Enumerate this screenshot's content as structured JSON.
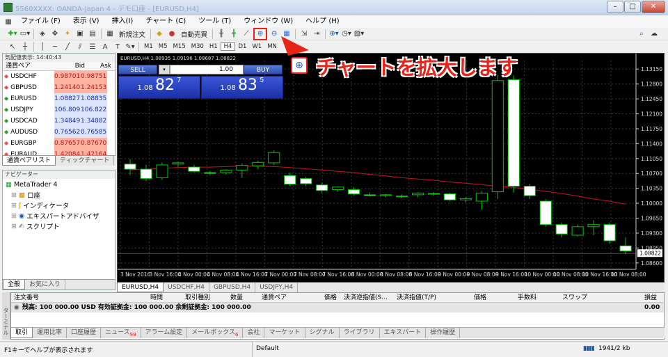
{
  "window": {
    "title": "5560XXXX: OANDA-Japan 4 - デモ口座 - [EURUSD,H4]",
    "min": "–",
    "max": "□",
    "close": "✕"
  },
  "menu": [
    "ファイル (F)",
    "表示 (V)",
    "挿入(I)",
    "チャート (C)",
    "ツール (T)",
    "ウィンドウ (W)",
    "ヘルプ (H)"
  ],
  "toolbar": {
    "new_order": "新規注文",
    "auto_trade": "自動売買",
    "timeframes": [
      "M1",
      "M5",
      "M15",
      "M30",
      "H1",
      "H4",
      "D1",
      "W1",
      "MN"
    ],
    "active_tf": "H4"
  },
  "callout": {
    "text": "チャートを拡大します",
    "color": "#e8231a"
  },
  "market_watch": {
    "header": "気配値表示: 14:40:43",
    "cols": [
      "通貨ペア",
      "Bid",
      "Ask"
    ],
    "rows": [
      {
        "sym": "USDCHF",
        "bid": "0.98701",
        "ask": "0.98751",
        "dir": "down"
      },
      {
        "sym": "GBPUSD",
        "bid": "1.24140",
        "ask": "1.24153",
        "dir": "down"
      },
      {
        "sym": "EURUSD",
        "bid": "1.08827",
        "ask": "1.08835",
        "dir": "up"
      },
      {
        "sym": "USDJPY",
        "bid": "106.809",
        "ask": "106.822",
        "dir": "up"
      },
      {
        "sym": "USDCAD",
        "bid": "1.34849",
        "ask": "1.34882",
        "dir": "up"
      },
      {
        "sym": "AUDUSD",
        "bid": "0.76562",
        "ask": "0.76585",
        "dir": "up"
      },
      {
        "sym": "EURGBP",
        "bid": "0.87657",
        "ask": "0.87670",
        "dir": "down"
      },
      {
        "sym": "EURAUD",
        "bid": "1.42084",
        "ask": "1.42164",
        "dir": "down"
      }
    ],
    "tabs": [
      "通貨ペアリスト",
      "ティックチャート"
    ]
  },
  "navigator": {
    "header": "ナビゲーター",
    "root": "MetaTrader 4",
    "items": [
      "口座",
      "インディケータ",
      "エキスパートアドバイザ",
      "スクリプト"
    ],
    "tabs": [
      "全般",
      "お気に入り"
    ]
  },
  "trade_panel": {
    "sell": "SELL",
    "buy": "BUY",
    "lot": "1.00",
    "sell_price_small": "1.08",
    "sell_price_big": "82",
    "sell_price_sup": "7",
    "buy_price_small": "1.08",
    "buy_price_big": "83",
    "buy_price_sup": "5"
  },
  "chart_tabs": [
    "EURUSD,H4",
    "USDCHF,H4",
    "GBPUSD,H4",
    "USDJPY,H4"
  ],
  "chart_data": {
    "type": "candlestick",
    "title": "EURUSD,H4 1.08935 1.09196 1.08687 1.08822",
    "x_labels": [
      "3 Nov 2016",
      "3 Nov 16:00",
      "4 Nov 00:00",
      "4 Nov 08:00",
      "4 Nov 16:00",
      "7 Nov 00:00",
      "7 Nov 08:00",
      "7 Nov 16:00",
      "8 Nov 00:00",
      "8 Nov 08:00",
      "8 Nov 16:00",
      "9 Nov 00:00",
      "9 Nov 08:00",
      "9 Nov 16:00",
      "10 Nov 00:00",
      "10 Nov 08:00",
      "10 Nov 16:00",
      "10 Nov 08:00"
    ],
    "y_ticks": [
      "1.13150",
      "1.12800",
      "1.12450",
      "1.12100",
      "1.11750",
      "1.11400",
      "1.11050",
      "1.10700",
      "1.10350",
      "1.10000",
      "1.09650",
      "1.09300",
      "1.08950",
      "1.08600"
    ],
    "ylim": [
      1.0845,
      1.1335
    ],
    "current_price": "1.08822",
    "candles": [
      {
        "o": 1.1092,
        "h": 1.1104,
        "l": 1.1066,
        "c": 1.108
      },
      {
        "o": 1.108,
        "h": 1.109,
        "l": 1.1052,
        "c": 1.1058
      },
      {
        "o": 1.106,
        "h": 1.1096,
        "l": 1.1055,
        "c": 1.109
      },
      {
        "o": 1.1092,
        "h": 1.1098,
        "l": 1.1084,
        "c": 1.1095
      },
      {
        "o": 1.1085,
        "h": 1.109,
        "l": 1.1072,
        "c": 1.1075
      },
      {
        "o": 1.1072,
        "h": 1.1076,
        "l": 1.1066,
        "c": 1.107
      },
      {
        "o": 1.1072,
        "h": 1.108,
        "l": 1.1068,
        "c": 1.1078
      },
      {
        "o": 1.1078,
        "h": 1.1094,
        "l": 1.106,
        "c": 1.1089
      },
      {
        "o": 1.1088,
        "h": 1.11,
        "l": 1.108,
        "c": 1.1096
      },
      {
        "o": 1.1095,
        "h": 1.1124,
        "l": 1.109,
        "c": 1.1119
      },
      {
        "o": 1.1065,
        "h": 1.1072,
        "l": 1.104,
        "c": 1.1045
      },
      {
        "o": 1.1058,
        "h": 1.1062,
        "l": 1.104,
        "c": 1.1046
      },
      {
        "o": 1.1043,
        "h": 1.1048,
        "l": 1.1025,
        "c": 1.103
      },
      {
        "o": 1.1032,
        "h": 1.104,
        "l": 1.1027,
        "c": 1.1038
      },
      {
        "o": 1.1032,
        "h": 1.1038,
        "l": 1.1018,
        "c": 1.1022
      },
      {
        "o": 1.102,
        "h": 1.1025,
        "l": 1.1016,
        "c": 1.1018
      },
      {
        "o": 1.1018,
        "h": 1.1022,
        "l": 1.1014,
        "c": 1.102
      },
      {
        "o": 1.1017,
        "h": 1.1021,
        "l": 1.1012,
        "c": 1.1016
      },
      {
        "o": 1.102,
        "h": 1.1026,
        "l": 1.1014,
        "c": 1.1024
      },
      {
        "o": 1.1022,
        "h": 1.1026,
        "l": 1.1018,
        "c": 1.1023
      },
      {
        "o": 1.1022,
        "h": 1.1025,
        "l": 1.1005,
        "c": 1.1008
      },
      {
        "o": 1.1008,
        "h": 1.1014,
        "l": 1.1002,
        "c": 1.1011
      },
      {
        "o": 1.1005,
        "h": 1.1028,
        "l": 1.0985,
        "c": 1.1024
      },
      {
        "o": 1.1027,
        "h": 1.1302,
        "l": 1.101,
        "c": 1.1288
      },
      {
        "o": 1.129,
        "h": 1.13,
        "l": 1.1025,
        "c": 1.104
      },
      {
        "o": 1.104,
        "h": 1.1046,
        "l": 1.101,
        "c": 1.1018
      },
      {
        "o": 1.1005,
        "h": 1.101,
        "l": 1.0945,
        "c": 1.095
      },
      {
        "o": 1.095,
        "h": 1.0955,
        "l": 1.092,
        "c": 1.0928
      },
      {
        "o": 1.0925,
        "h": 1.095,
        "l": 1.0922,
        "c": 1.0945
      },
      {
        "o": 1.0945,
        "h": 1.096,
        "l": 1.0925,
        "c": 1.095
      },
      {
        "o": 1.095,
        "h": 1.0955,
        "l": 1.0905,
        "c": 1.0912
      },
      {
        "o": 1.09,
        "h": 1.092,
        "l": 1.088,
        "c": 1.0888
      }
    ],
    "ma": [
      1.1078,
      1.108,
      1.1082,
      1.1084,
      1.1085,
      1.1085,
      1.1086,
      1.1087,
      1.1087,
      1.1086,
      1.1084,
      1.1081,
      1.1078,
      1.1075,
      1.1072,
      1.1068,
      1.1064,
      1.106,
      1.1057,
      1.1054,
      1.105,
      1.1047,
      1.1044,
      1.104,
      1.1037,
      1.1033,
      1.1028,
      1.1023,
      1.1017,
      1.101,
      1.1005,
      1.0998
    ],
    "bull_color": "#00c800",
    "bear_color": "#ffffff",
    "ma_color": "#c8141e",
    "grid": true
  },
  "terminal": {
    "cols": [
      "注文番号",
      "時間",
      "取引種別",
      "数量",
      "通貨ペア",
      "価格",
      "決済逆指値(S...",
      "決済指値(T/P)",
      "価格",
      "手数料",
      "スワップ",
      "損益"
    ],
    "balance": "残高: 100 000.00 USD  有効証拠金: 100 000.00  余剰証拠金: 100 000.00",
    "profit": "0.00",
    "side": "ターミナル",
    "tabs": [
      "取引",
      "運用比率",
      "口座履歴",
      "ニュース",
      "アラーム設定",
      "メールボックス",
      "会社",
      "マーケット",
      "シグナル",
      "ライブラリ",
      "エキスパート",
      "操作履歴"
    ],
    "news_badge": "99",
    "mail_badge": "6"
  },
  "status": {
    "help": "F1キーでヘルプが表示されます",
    "profile": "Default",
    "traffic": "1941/2 kb"
  }
}
